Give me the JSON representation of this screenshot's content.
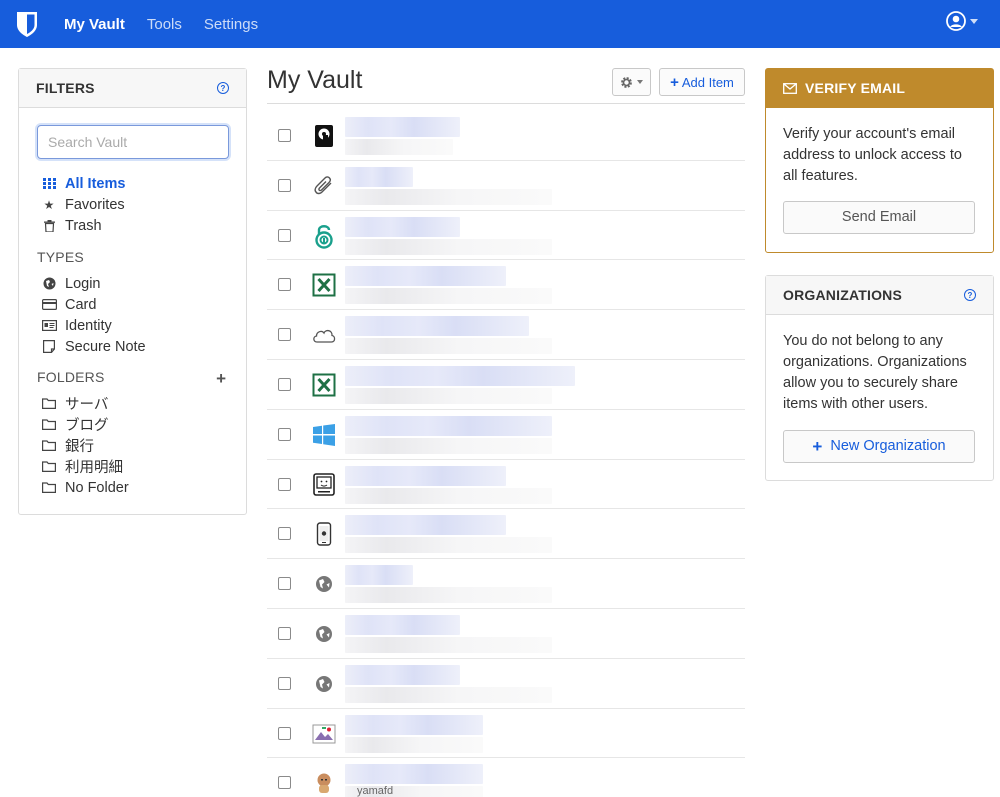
{
  "nav": {
    "links": [
      "My Vault",
      "Tools",
      "Settings"
    ],
    "brand_color": "#175ddc"
  },
  "filters": {
    "header": "FILTERS",
    "search_placeholder": "Search Vault",
    "items": [
      {
        "label": "All Items",
        "icon": "grid-icon",
        "active": true
      },
      {
        "label": "Favorites",
        "icon": "star-icon"
      },
      {
        "label": "Trash",
        "icon": "trash-icon"
      }
    ],
    "types_label": "TYPES",
    "types": [
      {
        "label": "Login",
        "icon": "globe-icon"
      },
      {
        "label": "Card",
        "icon": "credit-card-icon"
      },
      {
        "label": "Identity",
        "icon": "id-card-icon"
      },
      {
        "label": "Secure Note",
        "icon": "note-icon"
      }
    ],
    "folders_label": "FOLDERS",
    "folders": [
      {
        "label": "サーバ"
      },
      {
        "label": "ブログ"
      },
      {
        "label": "銀行"
      },
      {
        "label": "利用明細"
      },
      {
        "label": "No Folder"
      }
    ]
  },
  "main": {
    "title": "My Vault",
    "add_item_label": "Add Item",
    "items": [
      {
        "icon": "vault-device-icon",
        "w1": 115,
        "w2": 108
      },
      {
        "icon": "paperclip-icon",
        "w1": 68,
        "w2": 207
      },
      {
        "icon": "teal-lock-icon",
        "w1": 115,
        "w2": 207
      },
      {
        "icon": "excel-icon",
        "w1": 161,
        "w2": 207
      },
      {
        "icon": "cloud-icon",
        "w1": 184,
        "w2": 207
      },
      {
        "icon": "excel-icon",
        "w1": 230,
        "w2": 207
      },
      {
        "icon": "windows-icon",
        "w1": 207,
        "w2": 207
      },
      {
        "icon": "finder-icon",
        "w1": 161,
        "w2": 207
      },
      {
        "icon": "phone-icon",
        "w1": 161,
        "w2": 207
      },
      {
        "icon": "globe-icon",
        "w1": 68,
        "w2": 207
      },
      {
        "icon": "globe-icon",
        "w1": 115,
        "w2": 207
      },
      {
        "icon": "globe-icon",
        "w1": 115,
        "w2": 207
      },
      {
        "icon": "image-icon",
        "w1": 138,
        "w2": 138
      },
      {
        "icon": "avatar-icon",
        "w1": 138,
        "w2": 138,
        "sub": "yamafd"
      }
    ]
  },
  "verify_email": {
    "header": "VERIFY EMAIL",
    "body": "Verify your account's email address to unlock access to all features.",
    "button": "Send Email",
    "accent": "#bf8a2c"
  },
  "organizations": {
    "header": "ORGANIZATIONS",
    "body": "You do not belong to any organizations. Organizations allow you to securely share items with other users.",
    "button": "New Organization"
  }
}
